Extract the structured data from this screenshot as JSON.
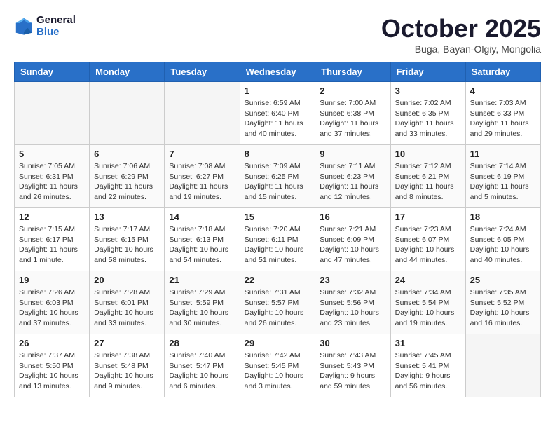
{
  "header": {
    "logo_line1": "General",
    "logo_line2": "Blue",
    "month_title": "October 2025",
    "location": "Buga, Bayan-Olgiy, Mongolia"
  },
  "days_of_week": [
    "Sunday",
    "Monday",
    "Tuesday",
    "Wednesday",
    "Thursday",
    "Friday",
    "Saturday"
  ],
  "weeks": [
    [
      {
        "num": "",
        "info": ""
      },
      {
        "num": "",
        "info": ""
      },
      {
        "num": "",
        "info": ""
      },
      {
        "num": "1",
        "info": "Sunrise: 6:59 AM\nSunset: 6:40 PM\nDaylight: 11 hours\nand 40 minutes."
      },
      {
        "num": "2",
        "info": "Sunrise: 7:00 AM\nSunset: 6:38 PM\nDaylight: 11 hours\nand 37 minutes."
      },
      {
        "num": "3",
        "info": "Sunrise: 7:02 AM\nSunset: 6:35 PM\nDaylight: 11 hours\nand 33 minutes."
      },
      {
        "num": "4",
        "info": "Sunrise: 7:03 AM\nSunset: 6:33 PM\nDaylight: 11 hours\nand 29 minutes."
      }
    ],
    [
      {
        "num": "5",
        "info": "Sunrise: 7:05 AM\nSunset: 6:31 PM\nDaylight: 11 hours\nand 26 minutes."
      },
      {
        "num": "6",
        "info": "Sunrise: 7:06 AM\nSunset: 6:29 PM\nDaylight: 11 hours\nand 22 minutes."
      },
      {
        "num": "7",
        "info": "Sunrise: 7:08 AM\nSunset: 6:27 PM\nDaylight: 11 hours\nand 19 minutes."
      },
      {
        "num": "8",
        "info": "Sunrise: 7:09 AM\nSunset: 6:25 PM\nDaylight: 11 hours\nand 15 minutes."
      },
      {
        "num": "9",
        "info": "Sunrise: 7:11 AM\nSunset: 6:23 PM\nDaylight: 11 hours\nand 12 minutes."
      },
      {
        "num": "10",
        "info": "Sunrise: 7:12 AM\nSunset: 6:21 PM\nDaylight: 11 hours\nand 8 minutes."
      },
      {
        "num": "11",
        "info": "Sunrise: 7:14 AM\nSunset: 6:19 PM\nDaylight: 11 hours\nand 5 minutes."
      }
    ],
    [
      {
        "num": "12",
        "info": "Sunrise: 7:15 AM\nSunset: 6:17 PM\nDaylight: 11 hours\nand 1 minute."
      },
      {
        "num": "13",
        "info": "Sunrise: 7:17 AM\nSunset: 6:15 PM\nDaylight: 10 hours\nand 58 minutes."
      },
      {
        "num": "14",
        "info": "Sunrise: 7:18 AM\nSunset: 6:13 PM\nDaylight: 10 hours\nand 54 minutes."
      },
      {
        "num": "15",
        "info": "Sunrise: 7:20 AM\nSunset: 6:11 PM\nDaylight: 10 hours\nand 51 minutes."
      },
      {
        "num": "16",
        "info": "Sunrise: 7:21 AM\nSunset: 6:09 PM\nDaylight: 10 hours\nand 47 minutes."
      },
      {
        "num": "17",
        "info": "Sunrise: 7:23 AM\nSunset: 6:07 PM\nDaylight: 10 hours\nand 44 minutes."
      },
      {
        "num": "18",
        "info": "Sunrise: 7:24 AM\nSunset: 6:05 PM\nDaylight: 10 hours\nand 40 minutes."
      }
    ],
    [
      {
        "num": "19",
        "info": "Sunrise: 7:26 AM\nSunset: 6:03 PM\nDaylight: 10 hours\nand 37 minutes."
      },
      {
        "num": "20",
        "info": "Sunrise: 7:28 AM\nSunset: 6:01 PM\nDaylight: 10 hours\nand 33 minutes."
      },
      {
        "num": "21",
        "info": "Sunrise: 7:29 AM\nSunset: 5:59 PM\nDaylight: 10 hours\nand 30 minutes."
      },
      {
        "num": "22",
        "info": "Sunrise: 7:31 AM\nSunset: 5:57 PM\nDaylight: 10 hours\nand 26 minutes."
      },
      {
        "num": "23",
        "info": "Sunrise: 7:32 AM\nSunset: 5:56 PM\nDaylight: 10 hours\nand 23 minutes."
      },
      {
        "num": "24",
        "info": "Sunrise: 7:34 AM\nSunset: 5:54 PM\nDaylight: 10 hours\nand 19 minutes."
      },
      {
        "num": "25",
        "info": "Sunrise: 7:35 AM\nSunset: 5:52 PM\nDaylight: 10 hours\nand 16 minutes."
      }
    ],
    [
      {
        "num": "26",
        "info": "Sunrise: 7:37 AM\nSunset: 5:50 PM\nDaylight: 10 hours\nand 13 minutes."
      },
      {
        "num": "27",
        "info": "Sunrise: 7:38 AM\nSunset: 5:48 PM\nDaylight: 10 hours\nand 9 minutes."
      },
      {
        "num": "28",
        "info": "Sunrise: 7:40 AM\nSunset: 5:47 PM\nDaylight: 10 hours\nand 6 minutes."
      },
      {
        "num": "29",
        "info": "Sunrise: 7:42 AM\nSunset: 5:45 PM\nDaylight: 10 hours\nand 3 minutes."
      },
      {
        "num": "30",
        "info": "Sunrise: 7:43 AM\nSunset: 5:43 PM\nDaylight: 9 hours\nand 59 minutes."
      },
      {
        "num": "31",
        "info": "Sunrise: 7:45 AM\nSunset: 5:41 PM\nDaylight: 9 hours\nand 56 minutes."
      },
      {
        "num": "",
        "info": ""
      }
    ]
  ]
}
